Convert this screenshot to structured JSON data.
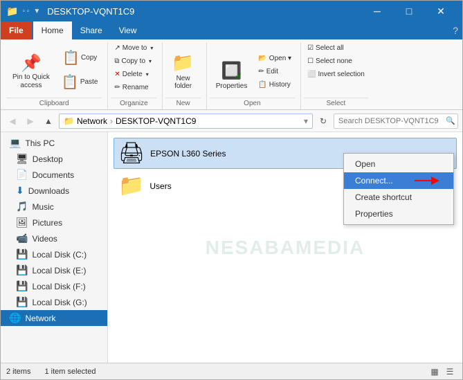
{
  "window": {
    "title": "DESKTOP-VQNT1C9",
    "controls": {
      "minimize": "─",
      "maximize": "□",
      "close": "✕"
    }
  },
  "ribbon": {
    "tabs": [
      {
        "id": "file",
        "label": "File"
      },
      {
        "id": "home",
        "label": "Home"
      },
      {
        "id": "share",
        "label": "Share"
      },
      {
        "id": "view",
        "label": "View"
      }
    ],
    "clipboard": {
      "label": "Clipboard",
      "pin_label": "Pin to Quick\naccess",
      "copy_label": "Copy",
      "paste_label": "Paste"
    },
    "organize": {
      "label": "Organize",
      "move_to": "Move to",
      "copy_to": "Copy to",
      "delete": "Delete",
      "rename": "Rename"
    },
    "new": {
      "label": "New",
      "new_folder": "New\nfolder"
    },
    "open": {
      "label": "Open",
      "properties": "Properties"
    },
    "select": {
      "label": "Select",
      "select_all": "Select all",
      "select_none": "Select none",
      "invert": "Invert selection"
    }
  },
  "address_bar": {
    "path_parts": [
      "Network",
      "DESKTOP-VQNT1C9"
    ],
    "search_placeholder": "Search DESKTOP-VQNT1C9"
  },
  "sidebar": {
    "items": [
      {
        "id": "this-pc",
        "label": "This PC",
        "icon": "💻"
      },
      {
        "id": "desktop",
        "label": "Desktop",
        "icon": "🖥"
      },
      {
        "id": "documents",
        "label": "Documents",
        "icon": "📄"
      },
      {
        "id": "downloads",
        "label": "Downloads",
        "icon": "⬇"
      },
      {
        "id": "music",
        "label": "Music",
        "icon": "🎵"
      },
      {
        "id": "pictures",
        "label": "Pictures",
        "icon": "🖼"
      },
      {
        "id": "videos",
        "label": "Videos",
        "icon": "📹"
      },
      {
        "id": "local-c",
        "label": "Local Disk (C:)",
        "icon": "💾"
      },
      {
        "id": "local-e",
        "label": "Local Disk (E:)",
        "icon": "💾"
      },
      {
        "id": "local-f",
        "label": "Local Disk (F:)",
        "icon": "💾"
      },
      {
        "id": "local-g",
        "label": "Local Disk (G:)",
        "icon": "💾"
      },
      {
        "id": "network",
        "label": "Network",
        "icon": "🌐"
      }
    ]
  },
  "content": {
    "items": [
      {
        "id": "epson",
        "name": "EPSON L360 Series",
        "icon": "🖨",
        "selected": true
      },
      {
        "id": "users",
        "name": "Users",
        "icon": "📁"
      }
    ],
    "watermark": "NESABAMEDIA"
  },
  "context_menu": {
    "items": [
      {
        "id": "open",
        "label": "Open"
      },
      {
        "id": "connect",
        "label": "Connect...",
        "highlighted": true
      },
      {
        "id": "create-shortcut",
        "label": "Create shortcut"
      },
      {
        "id": "properties",
        "label": "Properties"
      }
    ]
  },
  "status_bar": {
    "count": "2 items",
    "selected": "1 item selected",
    "view_icons": [
      "▦",
      "☰"
    ]
  }
}
